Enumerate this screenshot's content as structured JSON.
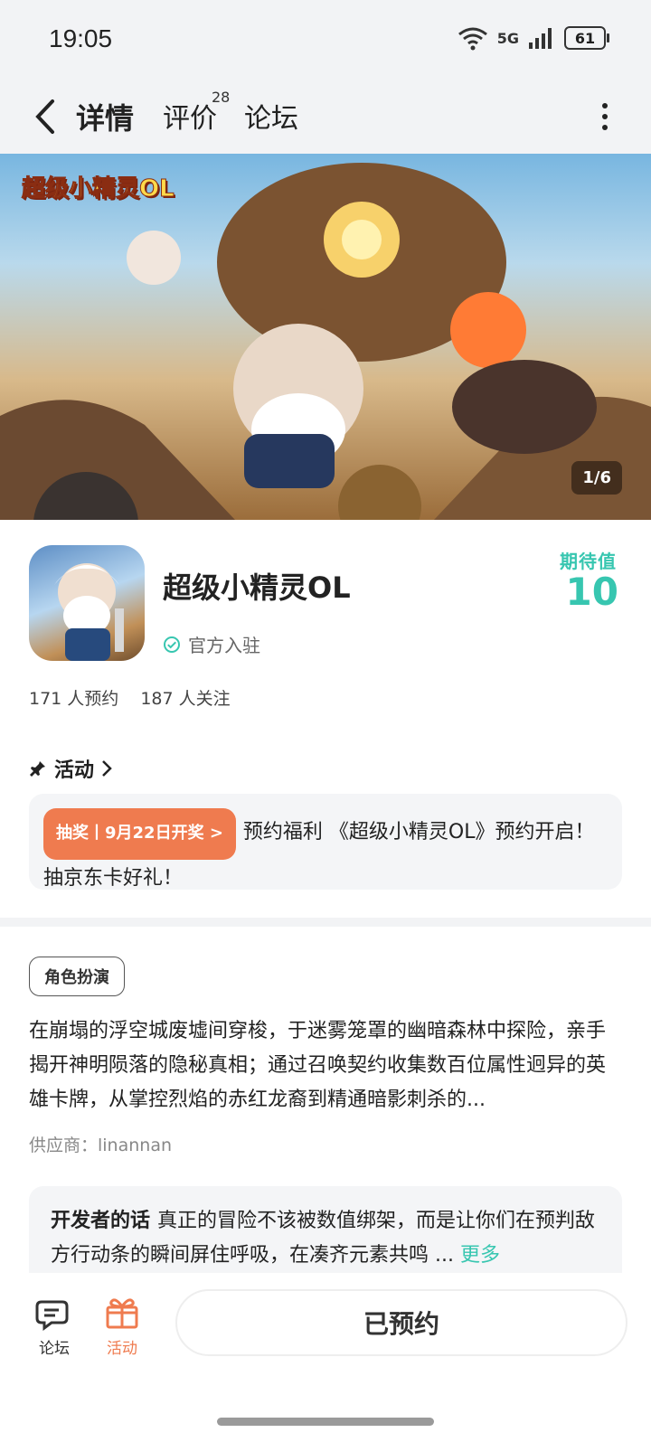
{
  "status_bar": {
    "time": "19:05",
    "battery": "61",
    "network": "5G"
  },
  "nav": {
    "tabs": [
      {
        "label": "详情",
        "active": true
      },
      {
        "label": "评价",
        "badge": "28"
      },
      {
        "label": "论坛"
      }
    ]
  },
  "banner": {
    "logo_text": "超级小精灵OL",
    "pager": "1/6"
  },
  "game": {
    "title": "超级小精灵OL",
    "official_label": "官方入驻",
    "expect_label": "期待值",
    "expect_value": "10",
    "reserve_count": "171 人预约",
    "follow_count": "187 人关注"
  },
  "activity": {
    "section_title": "活动",
    "lottery_badge": "抽奖丨9月22日开奖 >",
    "text": "预约福利 《超级小精灵OL》预约开启！抽京东卡好礼！"
  },
  "info": {
    "tag": "角色扮演",
    "description": "在崩塌的浮空城废墟间穿梭，于迷雾笼罩的幽暗森林中探险，亲手揭开神明陨落的隐秘真相；通过召唤契约收集数百位属性迥异的英雄卡牌，从掌控烈焰的赤红龙裔到精通暗影刺杀的...",
    "provider": "供应商：linannan"
  },
  "developer_note": {
    "label": "开发者的话",
    "text": "真正的冒险不该被数值绑架，而是让你们在预判敌方行动条的瞬间屏住呼吸，在凑齐元素共鸣 ...",
    "more": "更多"
  },
  "bottom_bar": {
    "forum": "论坛",
    "activity": "活动",
    "reserved_button": "已预约"
  },
  "colors": {
    "accent": "#37c6b0",
    "orange": "#ef7b4f",
    "background_gray": "#f2f3f5"
  }
}
